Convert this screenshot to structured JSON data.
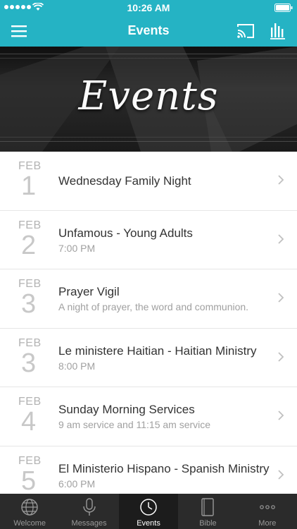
{
  "status_bar": {
    "time": "10:26 AM"
  },
  "nav": {
    "title": "Events"
  },
  "banner": {
    "title": "Events"
  },
  "events": [
    {
      "month": "FEB",
      "day": "1",
      "title": "Wednesday Family Night",
      "subtitle": ""
    },
    {
      "month": "FEB",
      "day": "2",
      "title": "Unfamous - Young Adults",
      "subtitle": "7:00 PM"
    },
    {
      "month": "FEB",
      "day": "3",
      "title": "Prayer Vigil",
      "subtitle": "A night of prayer, the word and communion."
    },
    {
      "month": "FEB",
      "day": "3",
      "title": "Le ministere Haitian - Haitian Ministry",
      "subtitle": "8:00 PM"
    },
    {
      "month": "FEB",
      "day": "4",
      "title": "Sunday Morning Services",
      "subtitle": "9 am service and 11:15 am service"
    },
    {
      "month": "FEB",
      "day": "5",
      "title": "El Ministerio Hispano - Spanish Ministry",
      "subtitle": "6:00 PM"
    }
  ],
  "tabs": [
    {
      "label": "Welcome",
      "icon": "globe-icon",
      "active": false
    },
    {
      "label": "Messages",
      "icon": "microphone-icon",
      "active": false
    },
    {
      "label": "Events",
      "icon": "clock-icon",
      "active": true
    },
    {
      "label": "Bible",
      "icon": "book-icon",
      "active": false
    },
    {
      "label": "More",
      "icon": "more-dots-icon",
      "active": false
    }
  ],
  "colors": {
    "accent": "#25b3c4",
    "tab_bar": "#2b2b2b",
    "date": "#c8c8c8"
  }
}
